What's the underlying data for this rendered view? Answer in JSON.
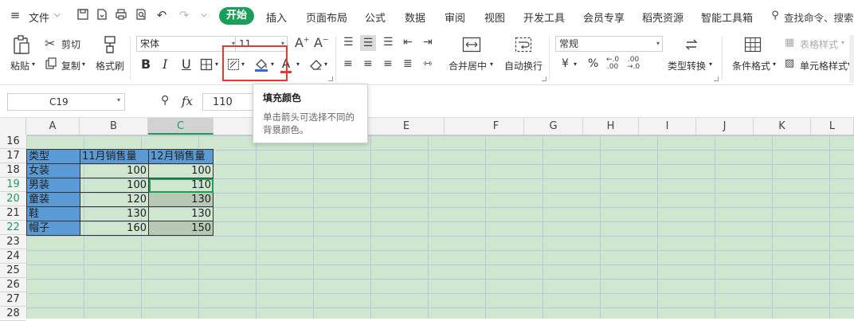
{
  "menubar": {
    "file_label": "文件",
    "tabs": [
      "开始",
      "插入",
      "页面布局",
      "公式",
      "数据",
      "审阅",
      "视图",
      "开发工具",
      "会员专享",
      "稻壳资源",
      "智能工具箱"
    ],
    "search_label": "查找命令、搜索"
  },
  "ribbon": {
    "paste": "粘贴",
    "cut": "剪切",
    "copy": "复制",
    "format_painter": "格式刷",
    "font_name": "宋体",
    "font_size": "11",
    "bold": "B",
    "italic": "I",
    "underline": "U",
    "font_color_glyph": "A",
    "merge_center": "合并居中",
    "wrap_text": "自动换行",
    "number_format": "常规",
    "currency": "¥",
    "percent": "%",
    "type_convert": "类型转换",
    "conditional_format": "条件格式",
    "table_style": "表格样式",
    "cell_style": "单元格样式",
    "highlight_color": "#e53935"
  },
  "formula": {
    "cell_ref": "C19",
    "fx": "fx",
    "value": "110"
  },
  "tooltip": {
    "title": "填充颜色",
    "description": "单击箭头可选择不同的背景颜色。"
  },
  "sheet": {
    "columns": [
      "A",
      "B",
      "C",
      "D",
      "E",
      "F",
      "G",
      "H",
      "I",
      "J",
      "K",
      "L"
    ],
    "rows": [
      "16",
      "17",
      "18",
      "19",
      "20",
      "21",
      "22",
      "23",
      "24",
      "25",
      "26",
      "27",
      "28"
    ],
    "table": {
      "headers": [
        "类型",
        "11月销售量",
        "12月销售量"
      ],
      "rows": [
        [
          "女装",
          "100",
          "100"
        ],
        [
          "男装",
          "100",
          "110"
        ],
        [
          "童装",
          "120",
          "130"
        ],
        [
          "鞋",
          "130",
          "130"
        ],
        [
          "帽子",
          "160",
          "150"
        ]
      ]
    },
    "header_fill": "#5b9bd5",
    "sheet_background": "#cfe7cf",
    "active_accent": "#1c9e5b"
  }
}
